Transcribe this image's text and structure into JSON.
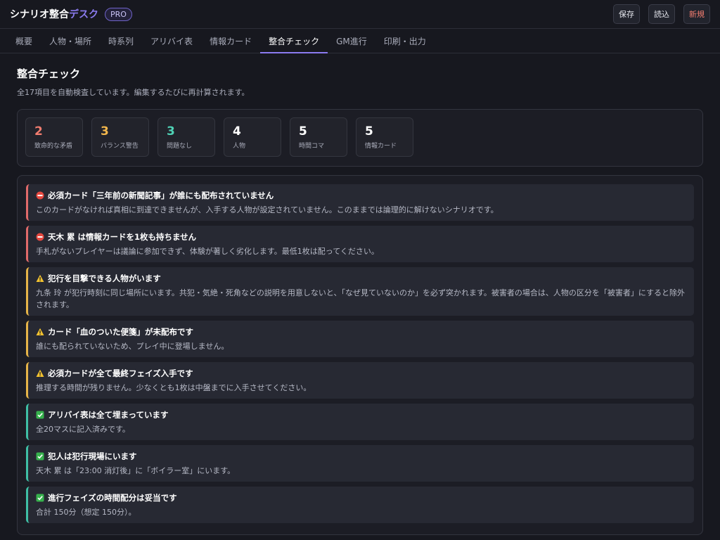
{
  "app": {
    "title_main": "シナリオ整合",
    "title_accent": "デスク",
    "badge": "PRO"
  },
  "header": {
    "save_label": "保存",
    "load_label": "読込",
    "new_label": "新規"
  },
  "tabs": [
    {
      "label": "概要"
    },
    {
      "label": "人物・場所"
    },
    {
      "label": "時系列"
    },
    {
      "label": "アリバイ表"
    },
    {
      "label": "情報カード"
    },
    {
      "label": "整合チェック",
      "active": true
    },
    {
      "label": "GM進行"
    },
    {
      "label": "印刷・出力"
    }
  ],
  "main": {
    "title": "整合チェック",
    "subtitle": "全17項目を自動検査しています。編集するたびに再計算されます。"
  },
  "stats": [
    {
      "value": "2",
      "label": "致命的な矛盾",
      "color": "#f07c6f"
    },
    {
      "value": "3",
      "label": "バランス警告",
      "color": "#f2b64c"
    },
    {
      "value": "3",
      "label": "問題なし",
      "color": "#4fd1b5"
    },
    {
      "value": "4",
      "label": "人物",
      "color": "#ffffff"
    },
    {
      "value": "5",
      "label": "時間コマ",
      "color": "#ffffff"
    },
    {
      "value": "5",
      "label": "情報カード",
      "color": "#ffffff"
    }
  ],
  "issues": [
    {
      "level": "error",
      "icon": "no-entry-icon",
      "title": "必須カード「三年前の新聞記事」が誰にも配布されていません",
      "desc": "このカードがなければ真相に到達できませんが、入手する人物が設定されていません。このままでは論理的に解けないシナリオです。"
    },
    {
      "level": "error",
      "icon": "no-entry-icon",
      "title": "天木 累 は情報カードを1枚も持ちません",
      "desc": "手札がないプレイヤーは議論に参加できず、体験が著しく劣化します。最低1枚は配ってください。"
    },
    {
      "level": "warning",
      "icon": "warning-icon",
      "title": "犯行を目撃できる人物がいます",
      "desc": "九条 玲 が犯行時刻に同じ場所にいます。共犯・気絶・死角などの説明を用意しないと、「なぜ見ていないのか」を必ず突かれます。被害者の場合は、人物の区分を「被害者」にすると除外されます。"
    },
    {
      "level": "warning",
      "icon": "warning-icon",
      "title": "カード「血のついた便箋」が未配布です",
      "desc": "誰にも配られていないため、プレイ中に登場しません。"
    },
    {
      "level": "warning",
      "icon": "warning-icon",
      "title": "必須カードが全て最終フェイズ入手です",
      "desc": "推理する時間が残りません。少なくとも1枚は中盤までに入手させてください。"
    },
    {
      "level": "ok",
      "icon": "check-icon",
      "title": "アリバイ表は全て埋まっています",
      "desc": "全20マスに記入済みです。"
    },
    {
      "level": "ok",
      "icon": "check-icon",
      "title": "犯人は犯行現場にいます",
      "desc": "天木 累 は「23:00 消灯後」に「ボイラー室」にいます。"
    },
    {
      "level": "ok",
      "icon": "check-icon",
      "title": "進行フェイズの時間配分は妥当です",
      "desc": "合計 150分（想定 150分）。"
    }
  ]
}
